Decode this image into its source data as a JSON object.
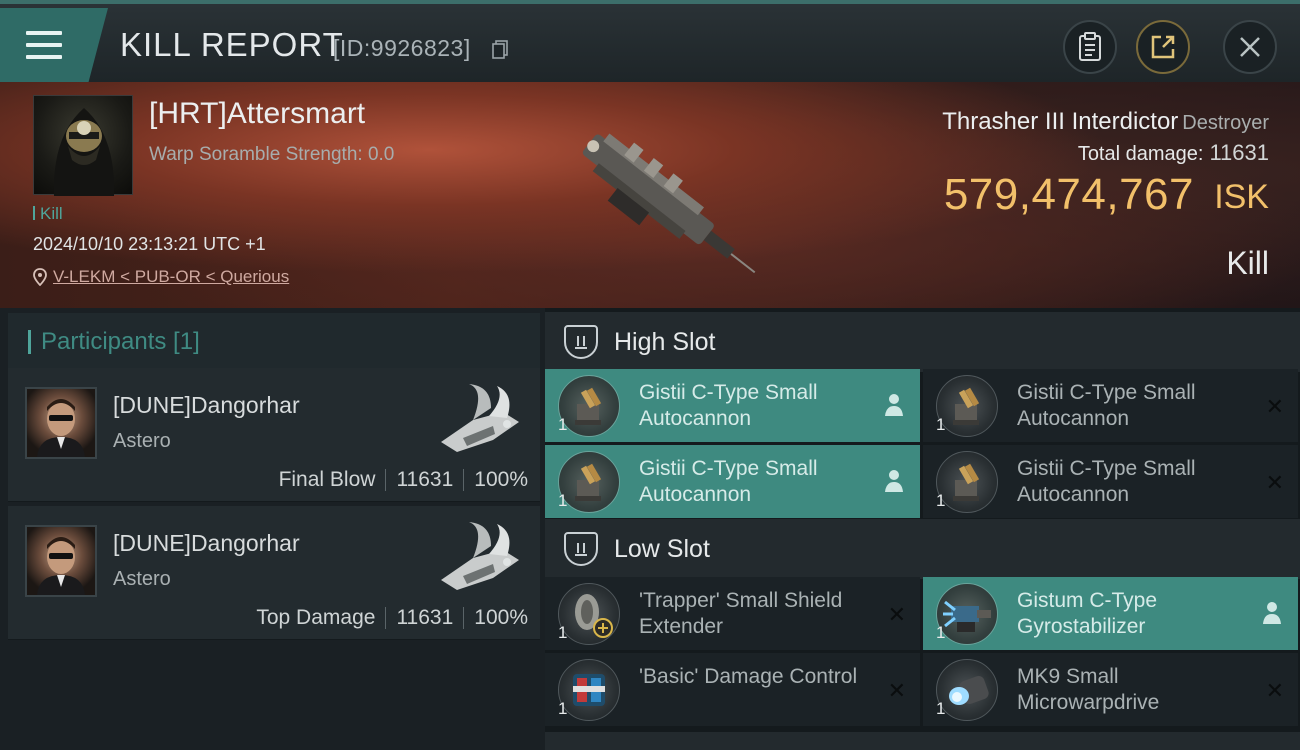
{
  "header": {
    "title": "KILL REPORT",
    "report_id": "[ID:9926823]"
  },
  "victim": {
    "name": "[HRT]Attersmart",
    "warp_scramble": "Warp Soramble Strength: 0.0",
    "tag": "Kill",
    "datetime": "2024/10/10 23:13:21 UTC +1",
    "location": "V-LEKM < PUB-OR < Querious",
    "ship_name": "Thrasher III Interdictor",
    "ship_class": "Destroyer",
    "total_damage_label": "Total damage:",
    "total_damage": "11631",
    "isk_value": "579,474,767",
    "isk_unit": "ISK",
    "result": "Kill"
  },
  "participants": {
    "header": "Participants [1]",
    "list": [
      {
        "name": "[DUNE]Dangorhar",
        "ship": "Astero",
        "role": "Final Blow",
        "damage": "11631",
        "percent": "100%"
      },
      {
        "name": "[DUNE]Dangorhar",
        "ship": "Astero",
        "role": "Top Damage",
        "damage": "11631",
        "percent": "100%"
      }
    ]
  },
  "fitting": {
    "high_slot_label": "High Slot",
    "low_slot_label": "Low Slot",
    "high": [
      {
        "name": "Gistii C-Type Small Autocannon",
        "qty": "1",
        "status": "fitted"
      },
      {
        "name": "Gistii C-Type Small Autocannon",
        "qty": "1",
        "status": "destroyed"
      },
      {
        "name": "Gistii C-Type Small Autocannon",
        "qty": "1",
        "status": "fitted"
      },
      {
        "name": "Gistii C-Type Small Autocannon",
        "qty": "1",
        "status": "destroyed"
      }
    ],
    "low": [
      {
        "name": "'Trapper' Small Shield Extender",
        "qty": "1",
        "status": "destroyed"
      },
      {
        "name": "Gistum C-Type Gyrostabilizer",
        "qty": "1",
        "status": "fitted"
      },
      {
        "name": "'Basic' Damage Control",
        "qty": "1",
        "status": "destroyed"
      },
      {
        "name": "MK9 Small Microwarpdrive",
        "qty": "1",
        "status": "destroyed"
      }
    ]
  },
  "colors": {
    "accent_teal": "#3e8a80",
    "isk_gold": "#f2c06a"
  }
}
